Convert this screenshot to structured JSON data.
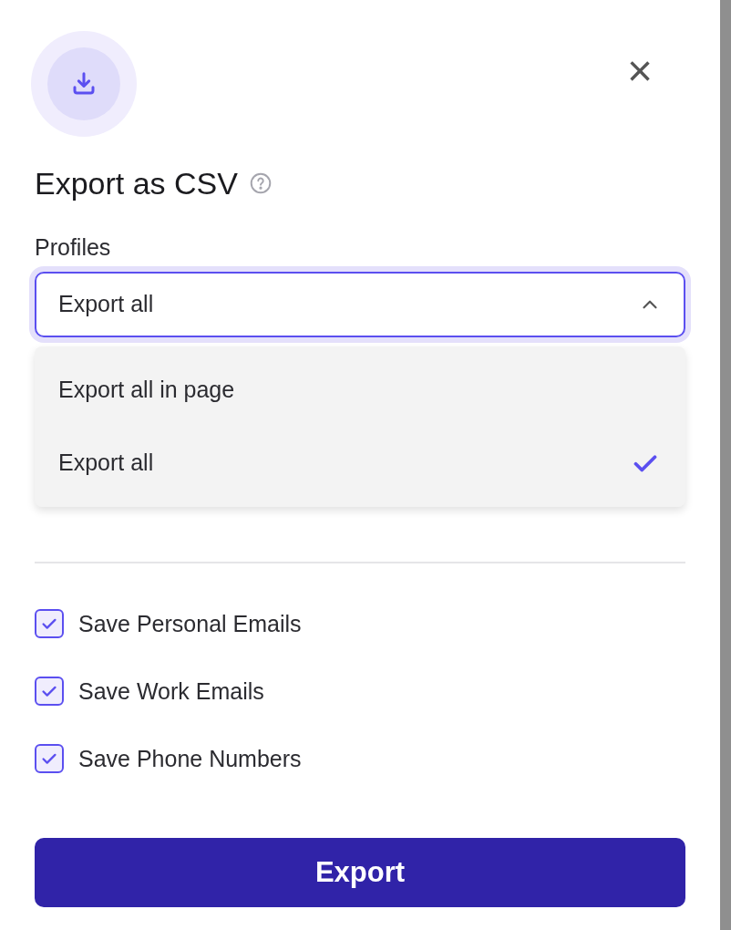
{
  "dialog": {
    "title": "Export as CSV",
    "close": "×"
  },
  "profiles": {
    "label": "Profiles",
    "value": "Export all",
    "expanded": true,
    "options": [
      {
        "label": "Export all in page",
        "selected": false
      },
      {
        "label": "Export all",
        "selected": true
      }
    ]
  },
  "options": [
    {
      "label": "Save Personal Emails",
      "checked": true
    },
    {
      "label": "Save Work Emails",
      "checked": true
    },
    {
      "label": "Save Phone Numbers",
      "checked": true
    }
  ],
  "export_button": "Export"
}
